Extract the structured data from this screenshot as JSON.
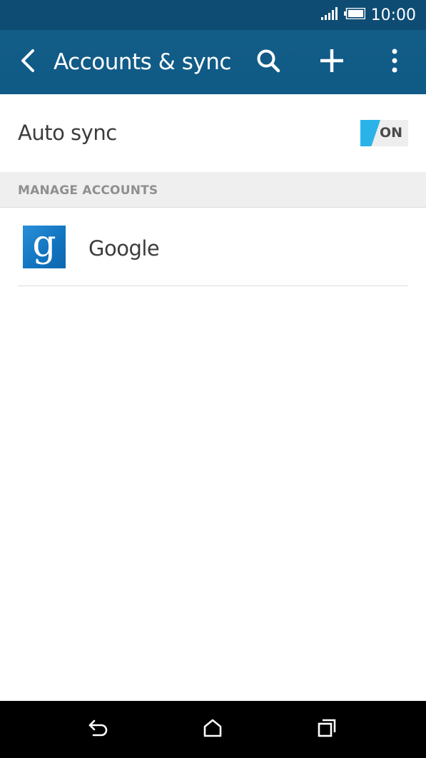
{
  "status_bar": {
    "time": "10:00",
    "signal_icon": "signal-bars-icon",
    "battery_icon": "battery-full-icon"
  },
  "action_bar": {
    "title": "Accounts & sync",
    "back_icon": "chevron-left-icon",
    "search_icon": "search-icon",
    "add_icon": "plus-icon",
    "more_icon": "more-vertical-icon"
  },
  "auto_sync": {
    "label": "Auto sync",
    "toggle_state": "ON"
  },
  "manage_accounts": {
    "header": "MANAGE ACCOUNTS",
    "accounts": [
      {
        "name": "Google",
        "icon": "google-icon"
      }
    ]
  },
  "colors": {
    "status_bar": "#0e4c73",
    "action_bar": "#135c88",
    "toggle_accent": "#2ab3e8",
    "google_blue": "#1173bf"
  },
  "nav_bar": {
    "back_icon": "nav-back-icon",
    "home_icon": "nav-home-icon",
    "recent_icon": "nav-recent-apps-icon"
  }
}
